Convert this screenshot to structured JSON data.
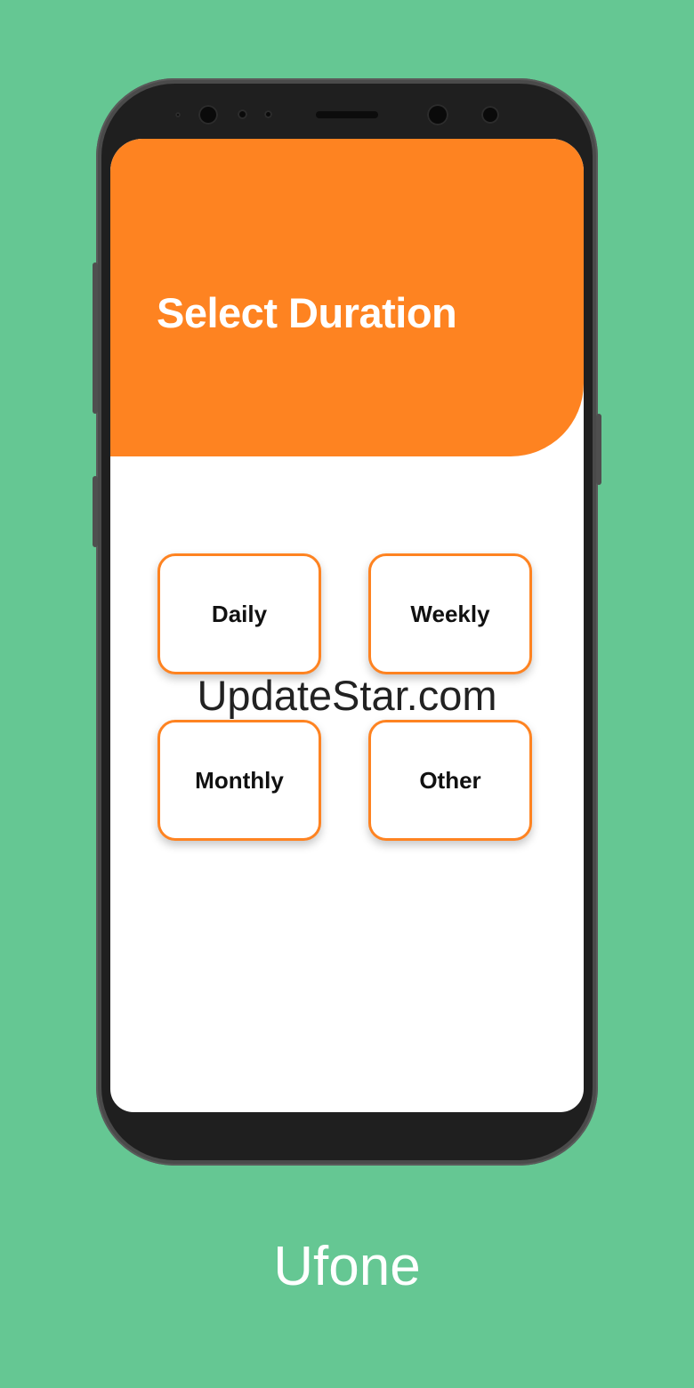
{
  "screen": {
    "title": "Select Duration",
    "options": [
      {
        "label": "Daily"
      },
      {
        "label": "Weekly"
      },
      {
        "label": "Monthly"
      },
      {
        "label": "Other"
      }
    ]
  },
  "watermark": "UpdateStar.com",
  "caption": "Ufone",
  "colors": {
    "background": "#65c793",
    "accent": "#fe8321",
    "device_frame": "#4a4a4a"
  }
}
